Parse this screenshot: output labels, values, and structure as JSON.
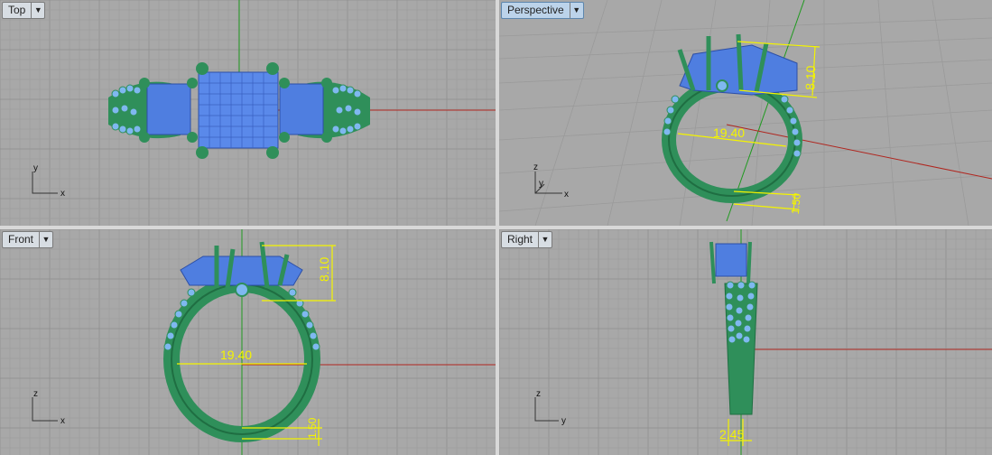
{
  "viewports": {
    "top": {
      "label": "Top",
      "menu_icon": "triangle-down",
      "axis_x": "x",
      "axis_y": "y"
    },
    "perspective": {
      "label": "Perspective",
      "menu_icon": "triangle-down",
      "axis_x": "x",
      "axis_y": "y",
      "axis_z": "z",
      "dim_height": "8.10",
      "dim_diameter": "19.40",
      "dim_band": "1.50"
    },
    "front": {
      "label": "Front",
      "menu_icon": "triangle-down",
      "axis_x": "x",
      "axis_z": "z",
      "dim_height": "8.10",
      "dim_diameter": "19.40",
      "dim_band": "1.50"
    },
    "right": {
      "label": "Right",
      "menu_icon": "triangle-down",
      "axis_y": "y",
      "axis_z": "z",
      "dim_width": "2.45"
    }
  },
  "colors": {
    "viewport_bg": "#a8a8a8",
    "grid_minor": "#9d9d9d",
    "grid_major": "#8a8a8a",
    "axis_x": "#b0261f",
    "axis_y": "#1f9a1f",
    "metal": "#2f8f5a",
    "gem": "#4f7ee0",
    "pave": "#7fb8f0",
    "dimension": "#f4f400",
    "active_tab": "#bcd3ea"
  }
}
